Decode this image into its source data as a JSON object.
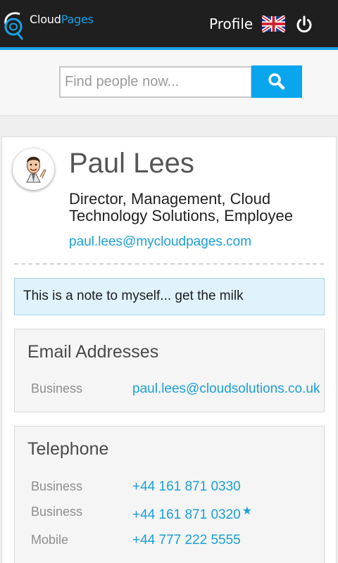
{
  "header": {
    "logo_text_primary": "Cloud",
    "logo_text_secondary": "Pages",
    "profile_label": "Profile"
  },
  "search": {
    "placeholder": "Find people now..."
  },
  "person": {
    "name": "Paul Lees",
    "role": "Director, Management, Cloud Technology Solutions, Employee",
    "email": "paul.lees@mycloudpages.com"
  },
  "note": "This is a note to myself... get the milk",
  "email_section": {
    "title": "Email Addresses",
    "rows": [
      {
        "label": "Business",
        "value": "paul.lees@cloudsolutions.co.uk"
      }
    ]
  },
  "phone_section": {
    "title": "Telephone",
    "rows": [
      {
        "label": "Business",
        "value": "+44 161 871 0330"
      },
      {
        "label": "Business",
        "value": "+44 161 871 0320",
        "starred": true
      },
      {
        "label": "Mobile",
        "value": "+44 777 222 5555"
      }
    ]
  },
  "colors": {
    "accent": "#1ba1e2",
    "link": "#1a9fd6",
    "topbar": "#1f1f1f",
    "note_bg": "#e0f2fb"
  }
}
